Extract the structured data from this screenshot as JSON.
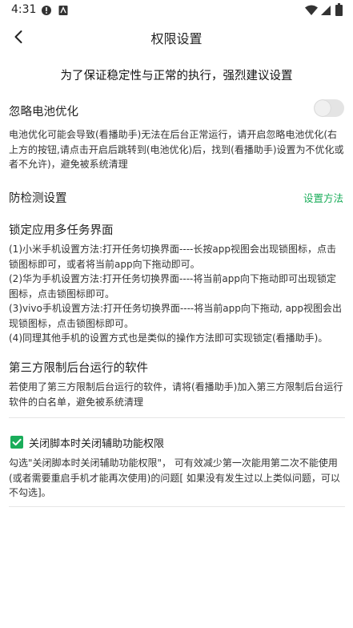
{
  "status": {
    "time": "4:31"
  },
  "header": {
    "title": "权限设置"
  },
  "notice": "为了保证稳定性与正常的执行，强烈建议设置",
  "battery": {
    "title": "忽略电池优化",
    "toggle_on": false,
    "description": "电池优化可能会导致(看播助手)无法在后台正常运行，请开启忽略电池优化(右上方的按钮,请点击开启后跳转到(电池优化)后，找到(看播助手)设置为不优化或者不允许)，避免被系统清理"
  },
  "anti_detect": {
    "title": "防检测设置",
    "link": "设置方法"
  },
  "lock": {
    "title": "锁定应用多任务界面",
    "items": [
      "(1)小米手机设置方法:打开任务切换界面----长按app视图会出现锁图标，点击锁图标即可，或者将当前app向下拖动即可。",
      "(2)华为手机设置方法:打开任务切换界面----将当前app向下拖动即可出现锁定图标，点击锁图标即可。",
      "(3)vivo手机设置方法:打开任务切换界面----将当前app向下拖动, app视图会出现锁图标，点击锁图标即可。",
      "(4)同理其他手机的设置方式也是类似的操作方法即可实现锁定(看播助手)。"
    ]
  },
  "third_party": {
    "title": "第三方限制后台运行的软件",
    "description": "若使用了第三方限制后台运行的软件，请将(看播助手)加入第三方限制后台运行软件的白名单，避免被系统清理"
  },
  "accessibility": {
    "checkbox_label": "关闭脚本时关闭辅助功能权限",
    "checked": true,
    "description": "勾选\"关闭脚本时关闭辅助功能权限\"， 可有效减少第一次能用第二次不能使用(或者需要重启手机才能再次使用)的问题[ 如果没有发生过以上类似问题，可以不勾选]。"
  },
  "colors": {
    "accent": "#1aad5a",
    "toggle_off": "#e4e4e4"
  }
}
